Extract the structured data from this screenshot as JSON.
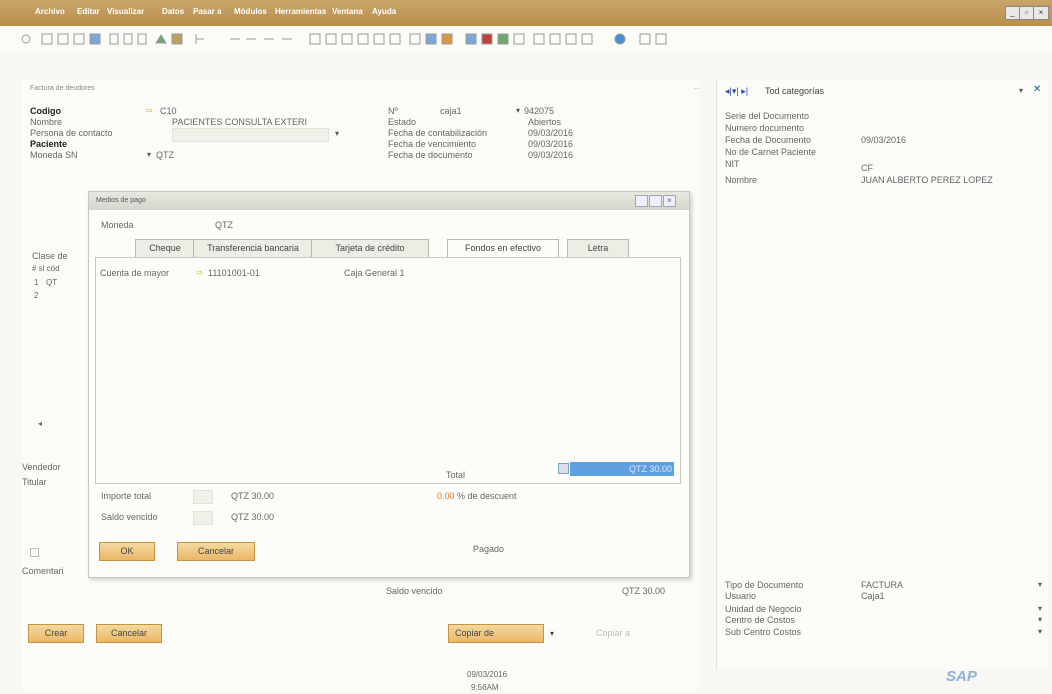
{
  "menubar": {
    "items": [
      "Archivo",
      "Editar",
      "Visualizar",
      "Datos",
      "Pasar a",
      "Módulos",
      "Herramientas",
      "Ventana",
      "Ayuda"
    ]
  },
  "document": {
    "window_title": "Factura de deudores",
    "left": [
      {
        "label": "Codigo",
        "value": "C10",
        "bold": true
      },
      {
        "label": "Nombre",
        "value": "PACIENTES CONSULTA EXTERI",
        "bold": false
      },
      {
        "label": "Persona de contacto",
        "value": "",
        "bold": false
      },
      {
        "label": "Paciente",
        "value": "",
        "bold": true
      },
      {
        "label": "Moneda SN",
        "value": "QTZ",
        "bold": false
      }
    ],
    "number_label": "Nº",
    "series": "caja1",
    "number": "942075",
    "right": [
      {
        "label": "Estado",
        "value": "Abiertos"
      },
      {
        "label": "Fecha de contabilización",
        "value": "09/03/2016"
      },
      {
        "label": "Fecha de vencimiento",
        "value": "09/03/2016"
      },
      {
        "label": "Fecha de documento",
        "value": "09/03/2016"
      }
    ],
    "partial_labels": [
      "Clase de",
      "# sl cód",
      "1",
      "QT",
      "2"
    ],
    "bottom_labels": [
      "Vendedor",
      "Titular",
      "Comentari"
    ],
    "saldo_label": "Saldo vencido",
    "saldo_value": "QTZ 30.00",
    "create_button": "Crear",
    "cancel_button": "Cancelar",
    "copy_from_button": "Copiar de",
    "copy_to_button": "Copiar a"
  },
  "right_panel": {
    "nav_label": "Tod categorías",
    "fields": [
      {
        "label": "Serie del Documento",
        "value": ""
      },
      {
        "label": "Numero documento",
        "value": ""
      },
      {
        "label": "Fecha de Documento",
        "value": "09/03/2016"
      },
      {
        "label": "No de Carnet Paciente",
        "value": ""
      },
      {
        "label": "NIT",
        "value": "CF"
      },
      {
        "label": "Nombre",
        "value": "JUAN ALBERTO PEREZ LOPEZ"
      }
    ],
    "bottom_fields": [
      {
        "label": "Tipo de Documento",
        "value": "FACTURA"
      },
      {
        "label": "Usuario",
        "value": "Caja1"
      },
      {
        "label": "Unidad de Negocio",
        "value": ""
      },
      {
        "label": "Centro de Costos",
        "value": ""
      },
      {
        "label": "Sub Centro Costos",
        "value": ""
      }
    ]
  },
  "dialog": {
    "title": "Medios de pago",
    "currency_label": "Moneda",
    "currency_value": "QTZ",
    "tabs": [
      "Cheque",
      "Transferencia bancaria",
      "Tarjeta de crédito",
      "Fondos en efectivo",
      "Letra"
    ],
    "active_tab": "Fondos en efectivo",
    "account_label": "Cuenta de mayor",
    "account_value": "11101001-01",
    "account_name": "Caja General 1",
    "total_label": "Total",
    "total_value": "QTZ 30.00",
    "importe_label": "Importe total",
    "importe_value": "QTZ 30.00",
    "discount_value": "0.00",
    "discount_label": "% de descuent",
    "saldo_label": "Saldo vencido",
    "saldo_value": "QTZ 30.00",
    "pagado_label": "Pagado",
    "ok_button": "OK",
    "cancel_button": "Cancelar"
  },
  "taskbar": {
    "date": "09/03/2016",
    "time": "9:56AM",
    "logo": "SAP"
  },
  "colors": {
    "menubar": "#b88f4c",
    "button": "#e9b766",
    "highlight": "#5fa0e0"
  }
}
